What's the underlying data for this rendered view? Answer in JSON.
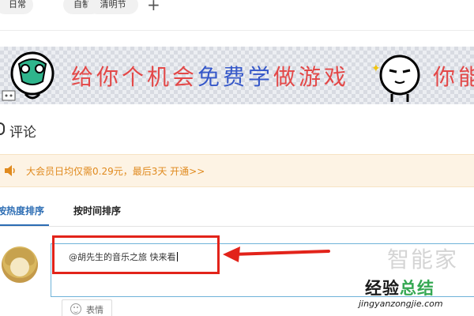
{
  "tags": {
    "items": [
      "日常",
      "自制",
      "清明节"
    ],
    "add_icon": "plus-icon"
  },
  "banner": {
    "line_part1": "给你个机会",
    "line_part2": "免费学",
    "line_part3": "做游戏",
    "line_tail": "你能",
    "colors": {
      "text": "#e34848",
      "accent": "#3658c9"
    }
  },
  "comments": {
    "title": "评论",
    "title_icon": "comment-icon"
  },
  "vip_notice": {
    "text": "大会员日均仅需0.29元，最后3天 开通>>",
    "icon": "speaker-icon",
    "color": "#e08a1e"
  },
  "sort": {
    "hot_label": "按热度排序",
    "time_label": "按时间排序",
    "active": "hot",
    "accent": "#2b6cb3"
  },
  "composer": {
    "input_value": "@胡先生的音乐之旅 快来看",
    "emoji_label": "表情",
    "border_color": "#6fb3d9",
    "highlight_color": "#e2231a"
  },
  "watermark": {
    "ghost": "智能家",
    "brand_part1": "经验",
    "brand_part2": "总结",
    "url": "jingyanzongjie.com"
  }
}
